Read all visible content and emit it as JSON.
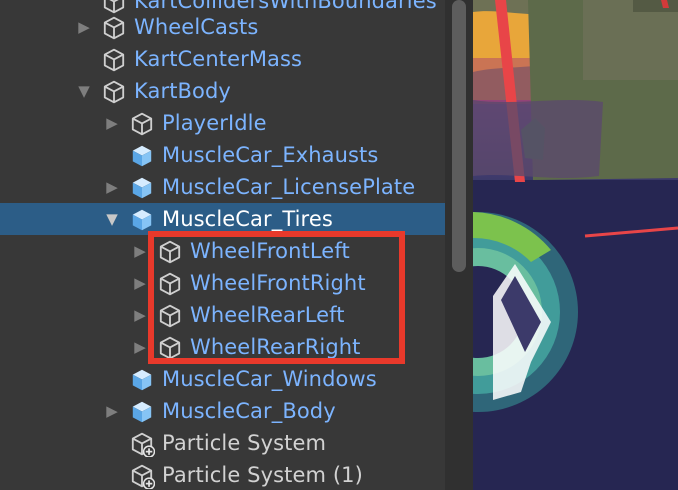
{
  "hierarchy": {
    "rows": [
      {
        "label": "KartCollidersWithBoundaries",
        "icon": "gameobject-icon"
      },
      {
        "label": "WheelCasts",
        "icon": "gameobject-icon",
        "arrow": "collapsed"
      },
      {
        "label": "KartCenterMass",
        "icon": "gameobject-icon"
      },
      {
        "label": "KartBody",
        "icon": "gameobject-icon",
        "arrow": "expanded"
      },
      {
        "label": "PlayerIdle",
        "icon": "gameobject-icon",
        "arrow": "collapsed"
      },
      {
        "label": "MuscleCar_Exhausts",
        "icon": "prefab-icon"
      },
      {
        "label": "MuscleCar_LicensePlate",
        "icon": "prefab-icon",
        "arrow": "collapsed"
      },
      {
        "label": "MuscleCar_Tires",
        "icon": "prefab-icon",
        "arrow": "expanded",
        "selected": true
      },
      {
        "label": "WheelFrontLeft",
        "icon": "gameobject-icon",
        "arrow": "collapsed"
      },
      {
        "label": "WheelFrontRight",
        "icon": "gameobject-icon",
        "arrow": "collapsed"
      },
      {
        "label": "WheelRearLeft",
        "icon": "gameobject-icon",
        "arrow": "collapsed"
      },
      {
        "label": "WheelRearRight",
        "icon": "gameobject-icon",
        "arrow": "collapsed"
      },
      {
        "label": "MuscleCar_Windows",
        "icon": "prefab-icon"
      },
      {
        "label": "MuscleCar_Body",
        "icon": "prefab-icon",
        "arrow": "collapsed"
      },
      {
        "label": "Particle System",
        "icon": "particle-system-icon"
      },
      {
        "label": "Particle System (1)",
        "icon": "particle-system-icon"
      }
    ]
  },
  "colors": {
    "panel_bg": "#383838",
    "selection_bg": "#2c5d87",
    "label_blue": "#7cb4ff",
    "label_white": "#ffffff",
    "label_plain": "#d2d2d2",
    "highlight_red": "#e8392b"
  }
}
